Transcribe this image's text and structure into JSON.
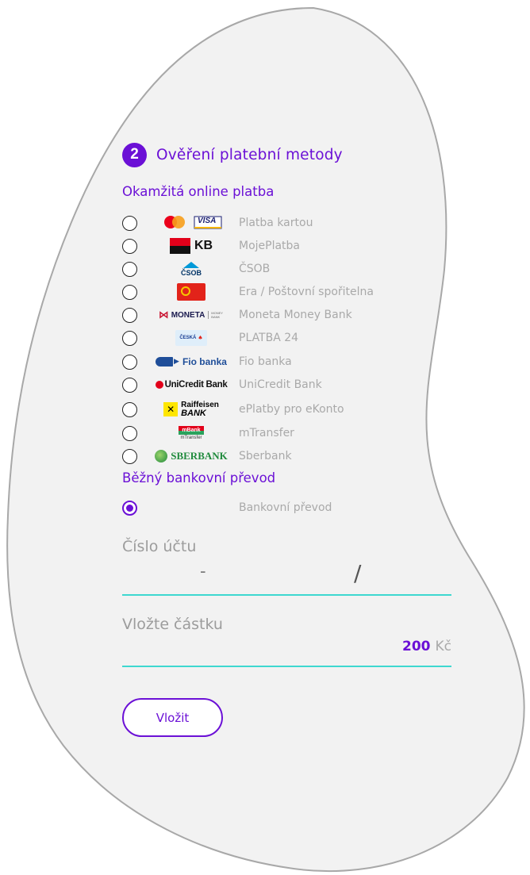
{
  "step": {
    "number": "2",
    "title": "Ověření platební metody"
  },
  "online": {
    "title": "Okamžitá online platba",
    "methods": [
      {
        "label": "Platba kartou",
        "logo": "mastercard-visa-logo",
        "logo_text": "VISA"
      },
      {
        "label": "MojePlatba",
        "logo": "kb-logo",
        "logo_text": "KB"
      },
      {
        "label": "ČSOB",
        "logo": "csob-logo",
        "logo_text": "ČSOB"
      },
      {
        "label": "Era / Poštovní spořitelna",
        "logo": "era-logo",
        "logo_text": ""
      },
      {
        "label": "Moneta Money Bank",
        "logo": "moneta-logo",
        "logo_text": "MONETA",
        "logo_sub": "MONEY BANK"
      },
      {
        "label": "PLATBA 24",
        "logo": "ceska-sporitelna-logo",
        "logo_text": "ČESKÁ"
      },
      {
        "label": "Fio banka",
        "logo": "fio-logo",
        "logo_text": "Fio banka"
      },
      {
        "label": "UniCredit Bank",
        "logo": "unicredit-logo",
        "logo_text": "UniCredit Bank"
      },
      {
        "label": "ePlatby pro eKonto",
        "logo": "raiffeisen-logo",
        "logo_text": "Raiffeisen",
        "logo_sub": "BANK"
      },
      {
        "label": "mTransfer",
        "logo": "mbank-logo",
        "logo_text": "mBank",
        "logo_sub": "mTransfer"
      },
      {
        "label": "Sberbank",
        "logo": "sberbank-logo",
        "logo_text": "SBERBANK"
      }
    ]
  },
  "transfer": {
    "title": "Běžný bankovní převod",
    "label": "Bankovní převod",
    "selected": true
  },
  "account": {
    "label": "Číslo účtu",
    "dash": "-",
    "slash": "/"
  },
  "amount": {
    "label": "Vložte částku",
    "value": "200",
    "currency": "Kč"
  },
  "submit": {
    "label": "Vložit"
  },
  "colors": {
    "accent": "#6b10d6",
    "field_line": "#3ed8d0",
    "muted_text": "#a9a9a9",
    "blob_fill": "#f2f2f2",
    "blob_stroke": "#a8a8a8"
  }
}
